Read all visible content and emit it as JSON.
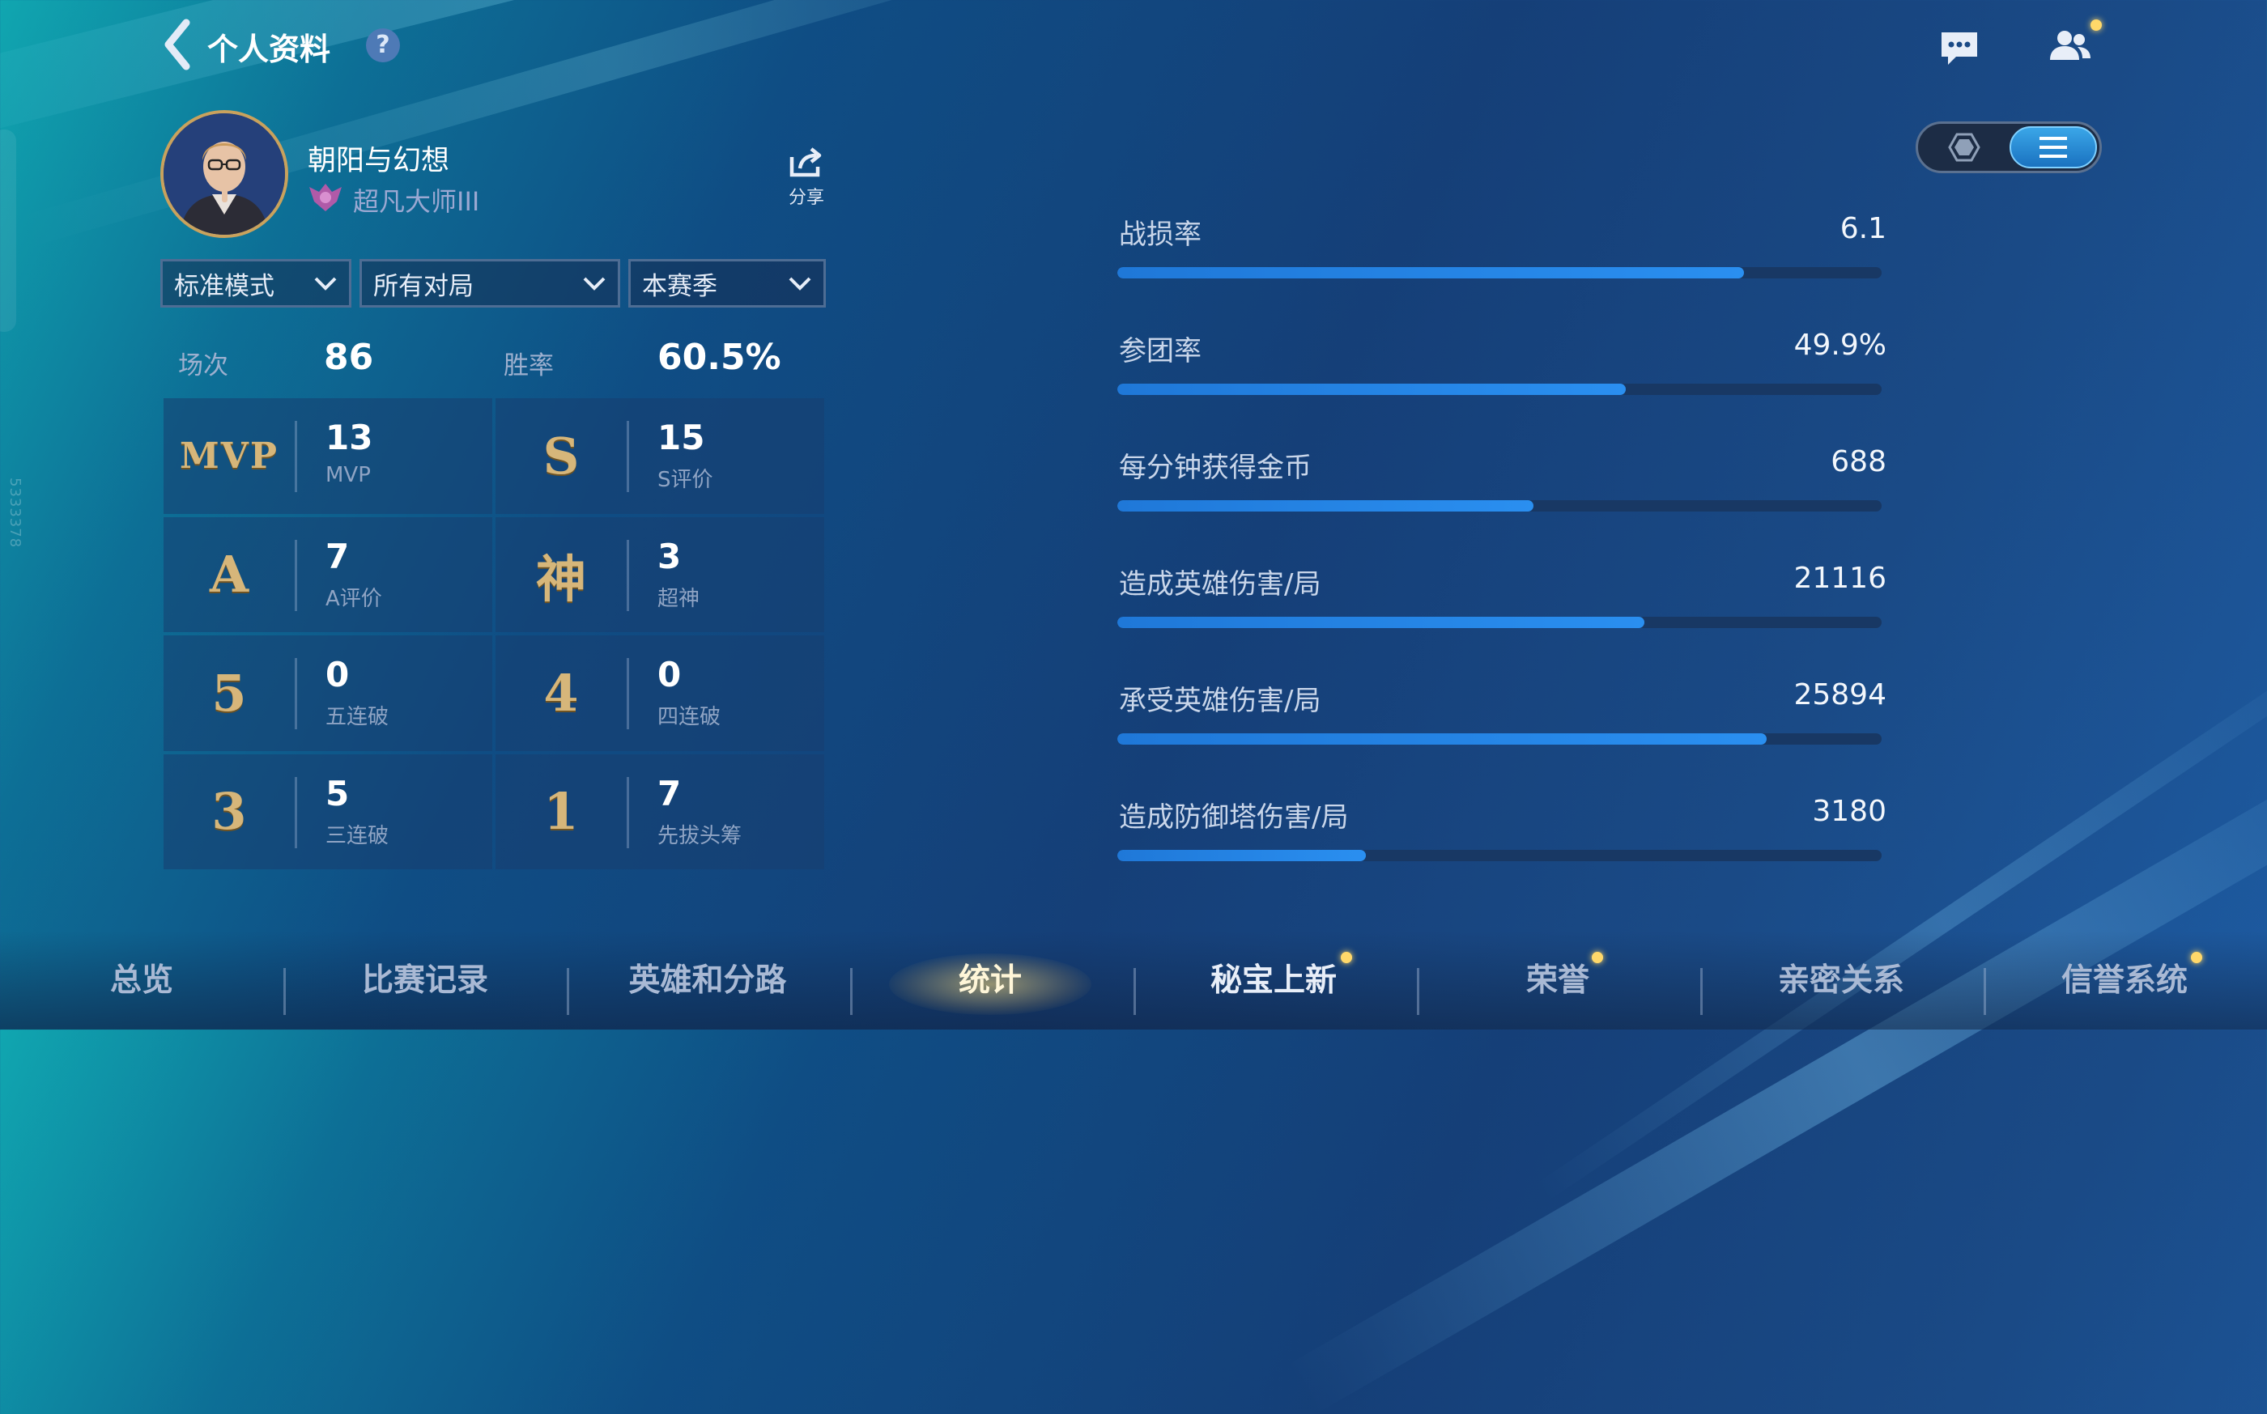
{
  "header": {
    "title": "个人资料",
    "help_label": "?"
  },
  "profile": {
    "username": "朝阳与幻想",
    "rank": "超凡大师III",
    "share_label": "分享"
  },
  "filters": [
    {
      "label": "标准模式"
    },
    {
      "label": "所有对局"
    },
    {
      "label": "本赛季"
    }
  ],
  "summary": {
    "matches_label": "场次",
    "matches_value": "86",
    "winrate_label": "胜率",
    "winrate_value": "60.5%"
  },
  "achievements": [
    {
      "glyph": "MVP",
      "value": "13",
      "label": "MVP"
    },
    {
      "glyph": "S",
      "value": "15",
      "label": "S评价"
    },
    {
      "glyph": "A",
      "value": "7",
      "label": "A评价"
    },
    {
      "glyph": "神",
      "value": "3",
      "label": "超神"
    },
    {
      "glyph": "5",
      "value": "0",
      "label": "五连破"
    },
    {
      "glyph": "4",
      "value": "0",
      "label": "四连破"
    },
    {
      "glyph": "3",
      "value": "5",
      "label": "三连破"
    },
    {
      "glyph": "1",
      "value": "7",
      "label": "先拔头筹"
    }
  ],
  "metrics": [
    {
      "label": "战损率",
      "value": "6.1",
      "progress": 0.82
    },
    {
      "label": "参团率",
      "value": "49.9%",
      "progress": 0.665
    },
    {
      "label": "每分钟获得金币",
      "value": "688",
      "progress": 0.545
    },
    {
      "label": "造成英雄伤害/局",
      "value": "21116",
      "progress": 0.69
    },
    {
      "label": "承受英雄伤害/局",
      "value": "25894",
      "progress": 0.85
    },
    {
      "label": "造成防御塔伤害/局",
      "value": "3180",
      "progress": 0.325
    }
  ],
  "side_tag": "5333378",
  "nav": {
    "tabs": [
      {
        "label": "总览",
        "badge": false
      },
      {
        "label": "比赛记录",
        "badge": false
      },
      {
        "label": "英雄和分路",
        "badge": false
      },
      {
        "label": "统计",
        "badge": false,
        "active": true
      },
      {
        "label": "秘宝上新",
        "badge": true
      },
      {
        "label": "荣誉",
        "badge": true
      },
      {
        "label": "亲密关系",
        "badge": false
      },
      {
        "label": "信誉系统",
        "badge": true
      }
    ]
  },
  "colors": {
    "accent": "#2a8ff0",
    "gold": "#d6b67a",
    "badge": "#ffd86a"
  }
}
